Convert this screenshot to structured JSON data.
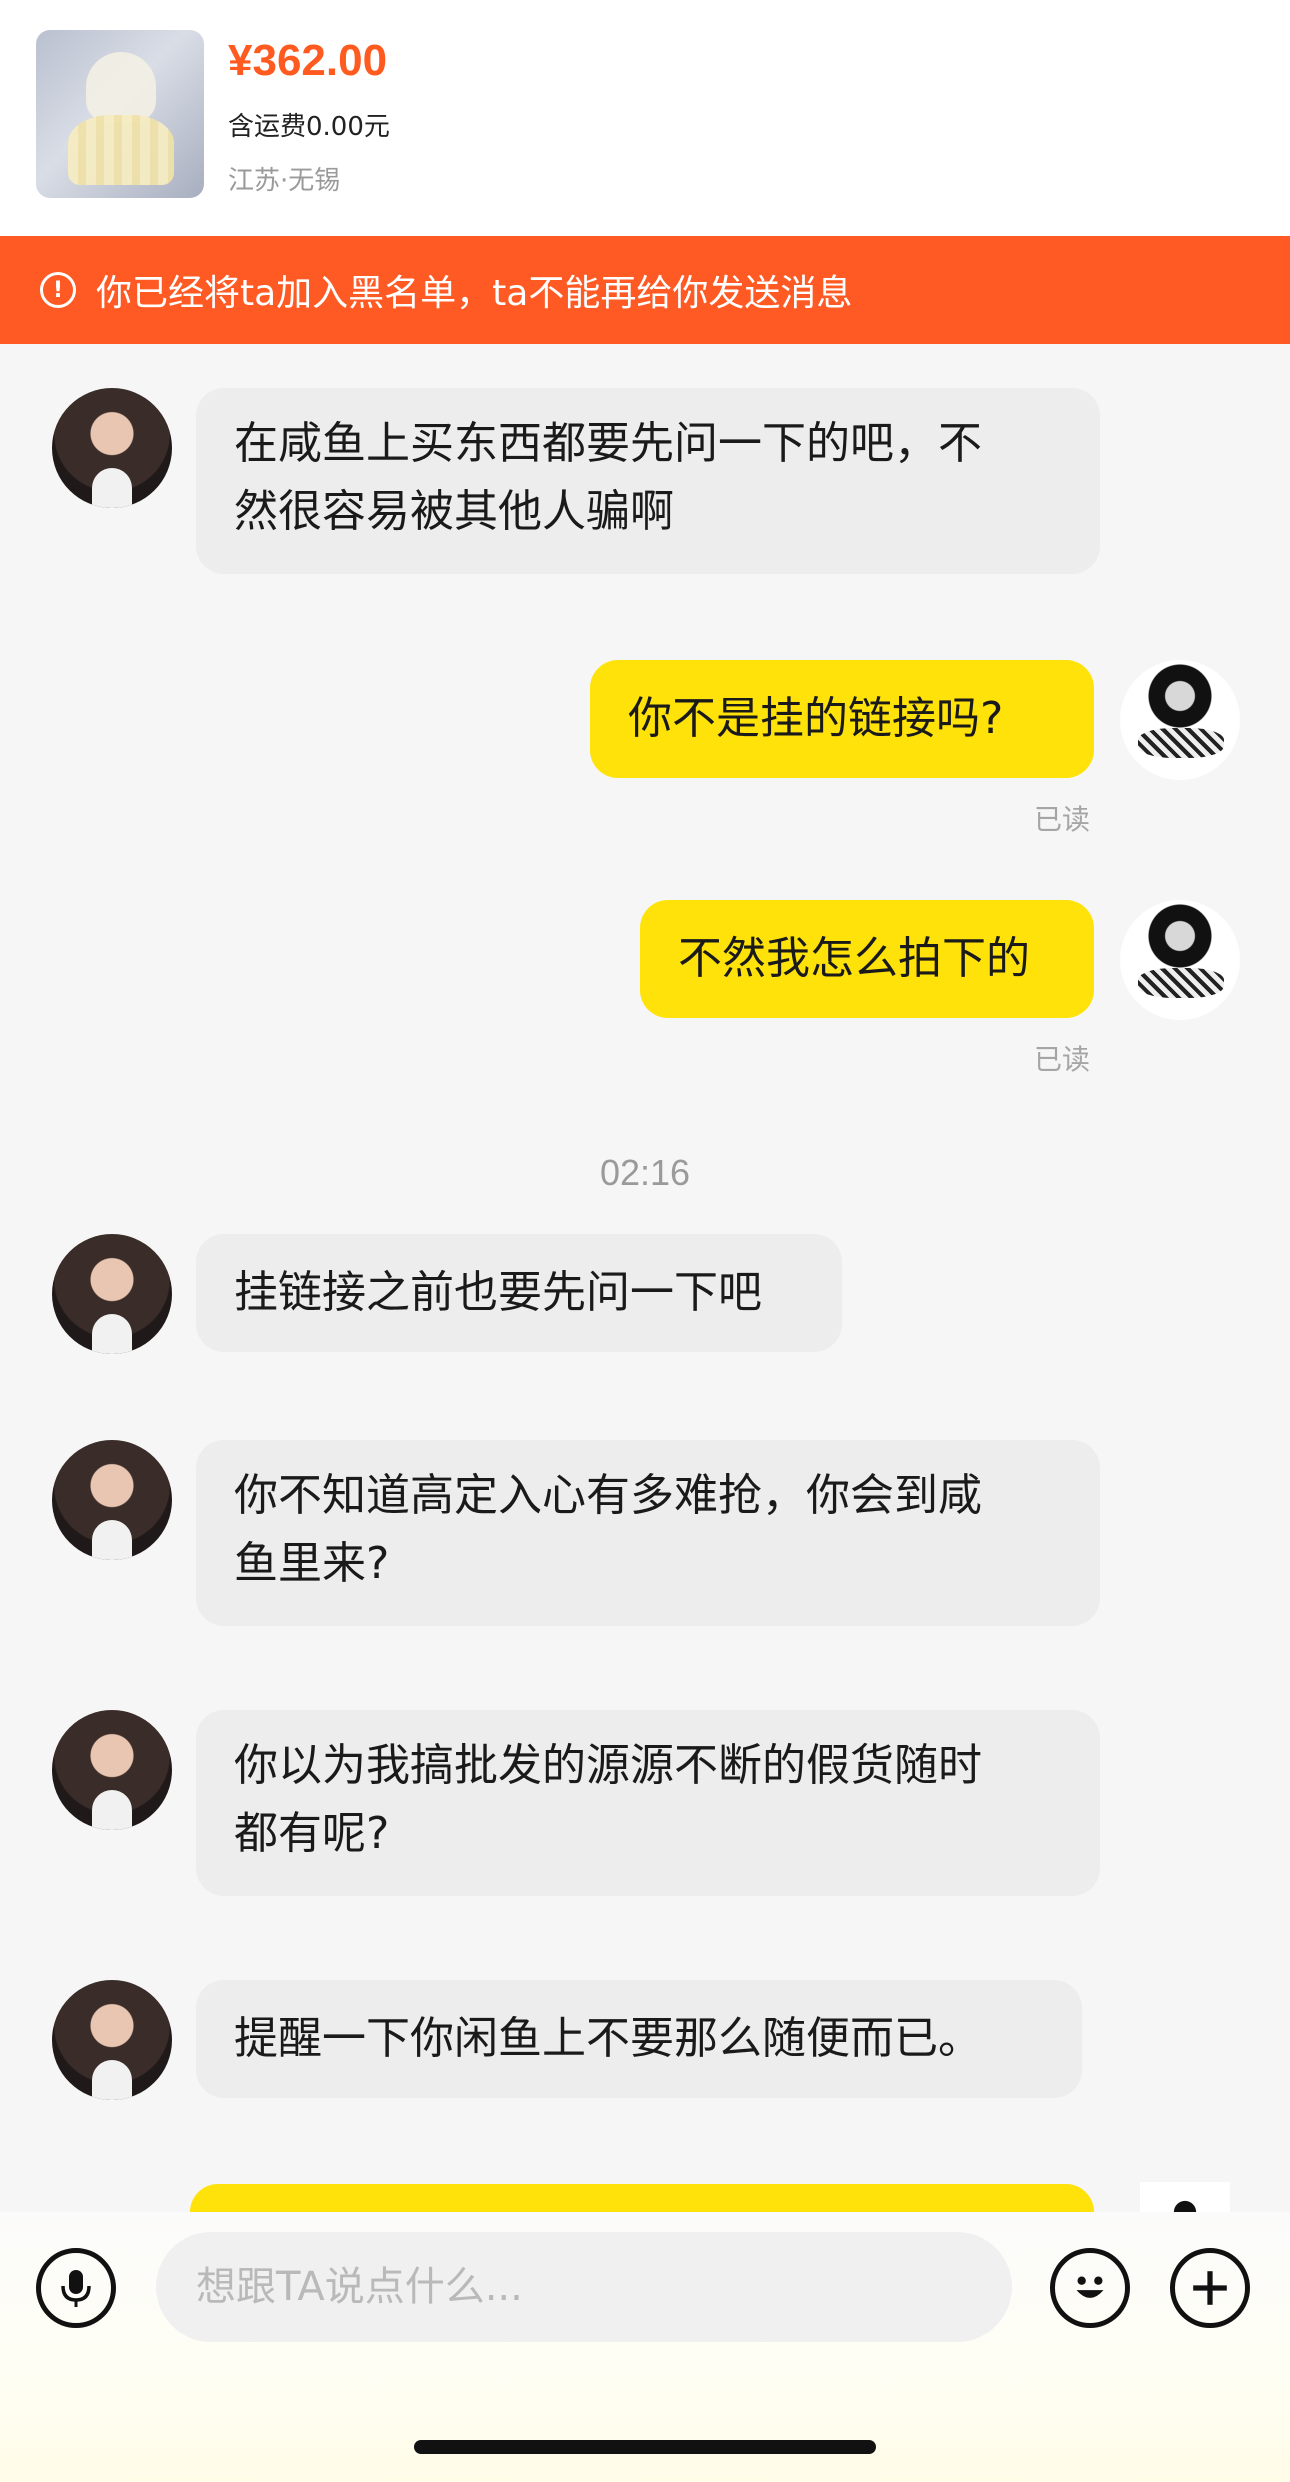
{
  "product": {
    "price": "¥362.00",
    "shipping": "含运费0.00元",
    "location": "江苏·无锡"
  },
  "banner": {
    "icon": "!",
    "text": "你已经将ta加入黑名单，ta不能再给你发送消息"
  },
  "messages": [
    {
      "side": "peer",
      "lines": [
        "在咸鱼上买东西都要先问一下的吧，不",
        "然很容易被其他人骗啊"
      ]
    },
    {
      "side": "me",
      "lines": [
        "你不是挂的链接吗?"
      ],
      "status": "已读"
    },
    {
      "side": "me",
      "lines": [
        "不然我怎么拍下的"
      ],
      "status": "已读"
    },
    {
      "side": "peer",
      "lines": [
        "挂链接之前也要先问一下吧"
      ]
    },
    {
      "side": "peer",
      "lines": [
        "你不知道高定入心有多难抢，你会到咸",
        "鱼里来?"
      ]
    },
    {
      "side": "peer",
      "lines": [
        "你以为我搞批发的源源不断的假货随时",
        "都有呢?"
      ]
    },
    {
      "side": "peer",
      "lines": [
        "提醒一下你闲鱼上不要那么随便而已。"
      ]
    }
  ],
  "timestamp": "02:16",
  "input": {
    "placeholder": "想跟TA说点什么..."
  },
  "icons": {
    "mic": "microphone-icon",
    "emoji": "emoji-icon",
    "plus": "plus-icon",
    "alert": "alert-circle-icon"
  },
  "colors": {
    "price": "#ff5a1f",
    "banner": "#ff5a24",
    "my_bubble": "#ffe20a",
    "peer_bubble": "#ededee"
  }
}
